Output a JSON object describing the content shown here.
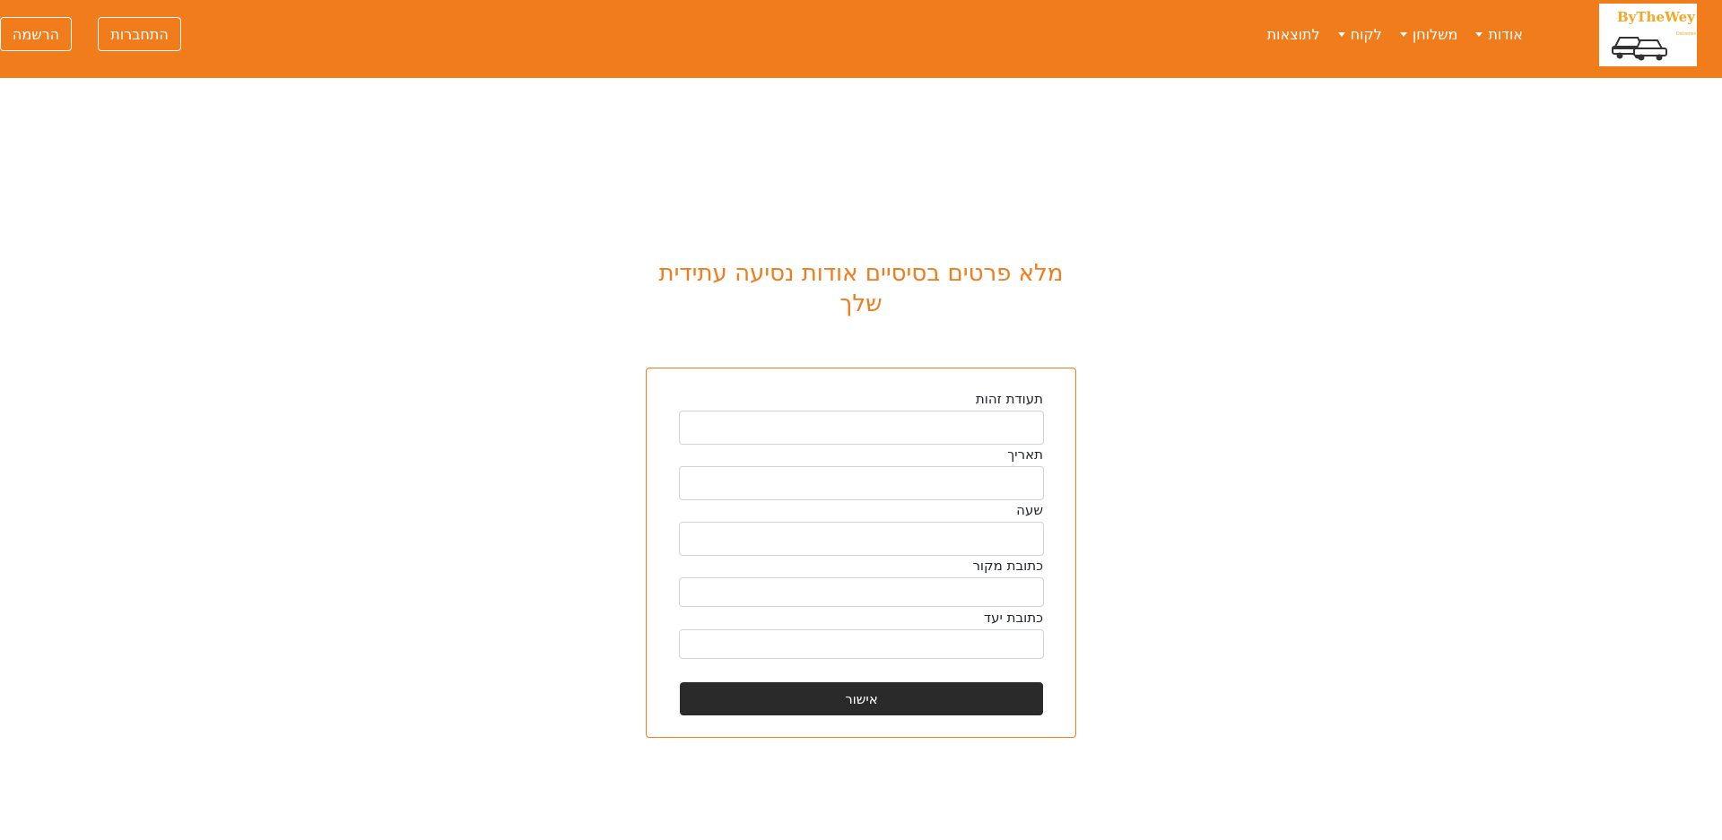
{
  "brand": {
    "name": "ByTheWey",
    "sub": "Deliveries"
  },
  "nav": {
    "items": [
      {
        "label": "אודות",
        "dropdown": true
      },
      {
        "label": "משלוחן",
        "dropdown": true
      },
      {
        "label": "לקוח",
        "dropdown": true
      },
      {
        "label": "לתוצאות",
        "dropdown": false
      }
    ],
    "login_label": "התחברות",
    "register_label": "הרשמה"
  },
  "heading": {
    "line1": "מלא פרטים בסיסיים אודות נסיעה עתידית",
    "line2": "שלך"
  },
  "form": {
    "fields": [
      {
        "label": "תעודת זהות",
        "value": ""
      },
      {
        "label": "תאריך",
        "value": ""
      },
      {
        "label": "שעה",
        "value": ""
      },
      {
        "label": "כתובת מקור",
        "value": ""
      },
      {
        "label": "כתובת יעד",
        "value": ""
      }
    ],
    "submit_label": "אישור"
  },
  "colors": {
    "accent": "#f07c1c",
    "button_dark": "#2a2a2a"
  }
}
